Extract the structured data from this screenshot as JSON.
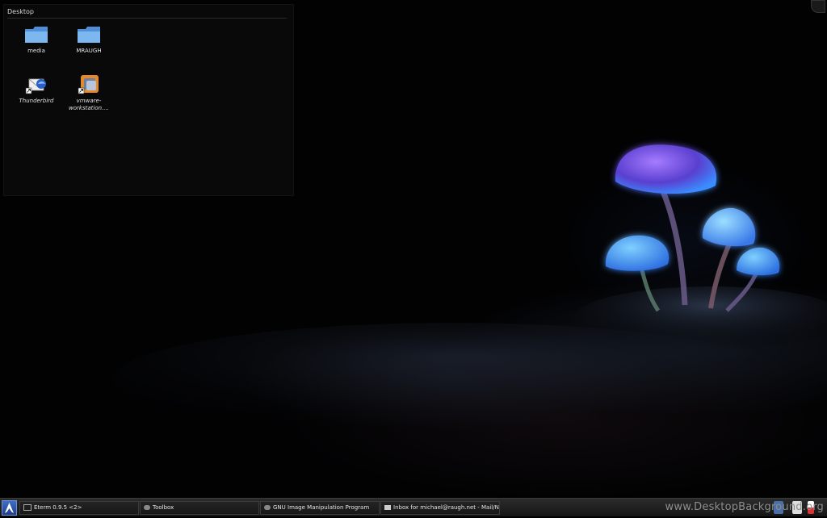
{
  "desktop": {
    "title": "Desktop",
    "icons": [
      {
        "label": "media",
        "icon": "folder-icon"
      },
      {
        "label": "MRAUGH",
        "icon": "folder-icon"
      },
      {
        "label": "Thunderbird",
        "icon": "thunderbird-icon"
      },
      {
        "label": "vmware-workstation....",
        "icon": "vmware-icon"
      }
    ]
  },
  "taskbar": {
    "tasks": [
      {
        "label": "Eterm 0.9.5 <2>"
      },
      {
        "label": "Toolbox"
      },
      {
        "label": "GNU Image Manipulation Program"
      },
      {
        "label": "Inbox for michael@raugh.net - Mail/N"
      }
    ],
    "watermark": "www.DesktopBackground.org"
  },
  "colors": {
    "folder": "#6aa6e8",
    "taskbar": "#1f1f1f",
    "accent": "#3f6fc9"
  }
}
